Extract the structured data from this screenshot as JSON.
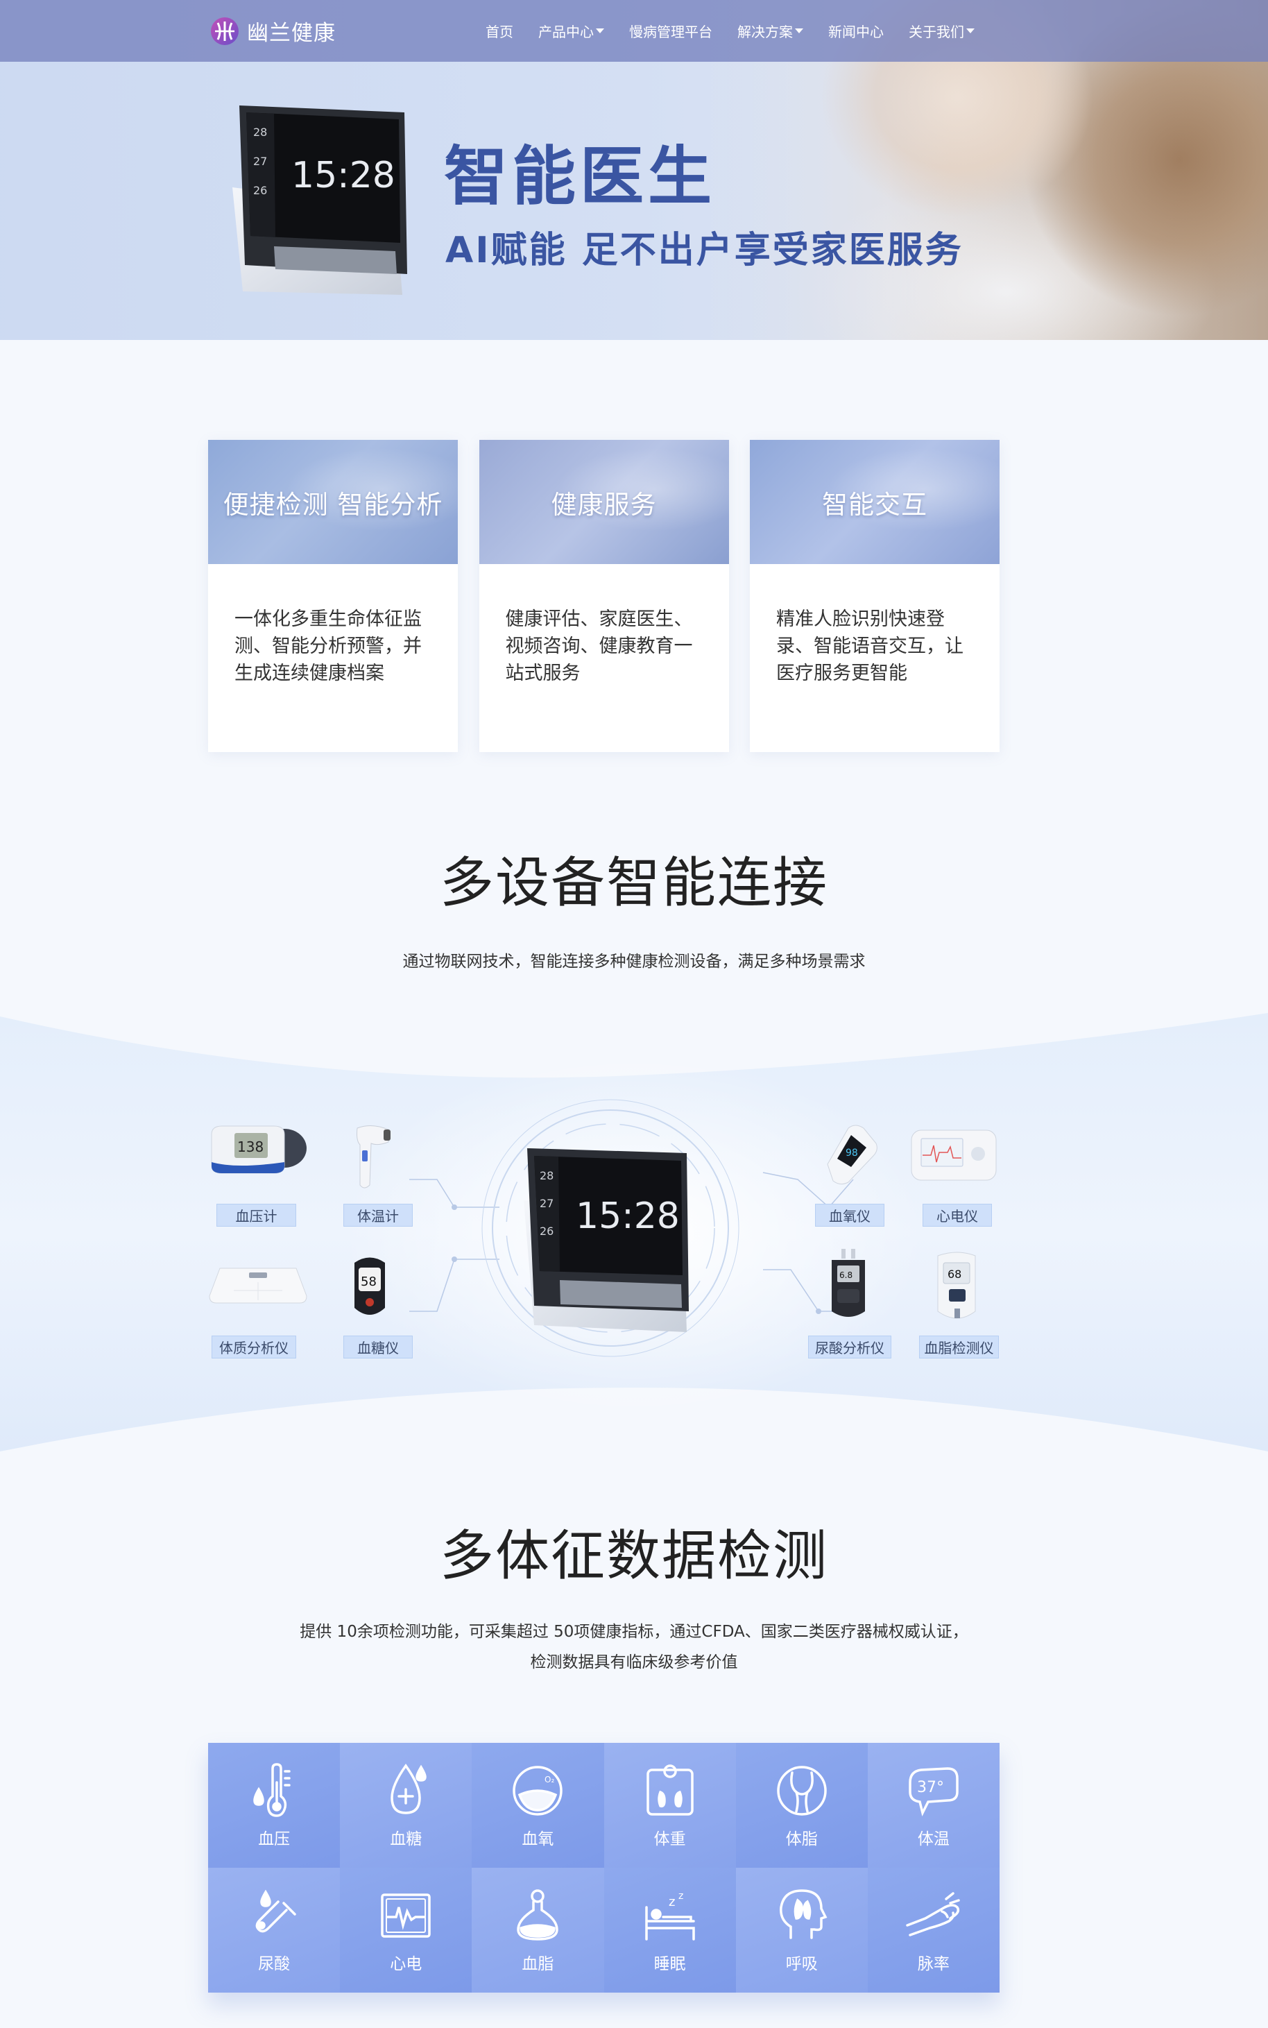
{
  "nav": {
    "logo_text": "幽兰健康",
    "items": [
      {
        "label": "首页",
        "dropdown": false
      },
      {
        "label": "产品中心",
        "dropdown": true
      },
      {
        "label": "慢病管理平台",
        "dropdown": false
      },
      {
        "label": "解决方案",
        "dropdown": true
      },
      {
        "label": "新闻中心",
        "dropdown": false
      },
      {
        "label": "关于我们",
        "dropdown": true
      }
    ]
  },
  "hero": {
    "title": "智能医生",
    "subtitle": "AI赋能  足不出户享受家医服务",
    "device_time": "15:28",
    "device_dates": [
      "28",
      "27",
      "26"
    ]
  },
  "features": [
    {
      "title": "便捷检测 智能分析",
      "body": "一体化多重生命体征监测、智能分析预警，并生成连续健康档案"
    },
    {
      "title": "健康服务",
      "body": "健康评估、家庭医生、视频咨询、健康教育一站式服务"
    },
    {
      "title": "智能交互",
      "body": "精准人脸识别快速登录、智能语音交互，让医疗服务更智能"
    }
  ],
  "connect": {
    "title": "多设备智能连接",
    "desc": "通过物联网技术，智能连接多种健康检测设备，满足多种场景需求",
    "devices_left": [
      "血压计",
      "体温计",
      "体质分析仪",
      "血糖仪"
    ],
    "devices_right": [
      "血氧仪",
      "心电仪",
      "尿酸分析仪",
      "血脂检测仪"
    ],
    "glucose_reading": "58",
    "oximeter_reading": "98",
    "lipid_reading": "68"
  },
  "vitals": {
    "title": "多体征数据检测",
    "desc_line1": "提供 10余项检测功能，可采集超过 50项健康指标，通过CFDA、国家二类医疗器械权威认证，",
    "desc_line2": "检测数据具有临床级参考价值",
    "items": [
      {
        "label": "血压",
        "icon": "thermometer-drop-icon"
      },
      {
        "label": "血糖",
        "icon": "blood-drop-plus-icon"
      },
      {
        "label": "血氧",
        "icon": "oxygen-icon"
      },
      {
        "label": "体重",
        "icon": "scale-icon"
      },
      {
        "label": "体脂",
        "icon": "body-fat-icon"
      },
      {
        "label": "体温",
        "icon": "temperature-icon"
      },
      {
        "label": "尿酸",
        "icon": "flask-drop-icon"
      },
      {
        "label": "心电",
        "icon": "ecg-icon"
      },
      {
        "label": "血脂",
        "icon": "lipid-bottle-icon"
      },
      {
        "label": "睡眠",
        "icon": "sleep-icon"
      },
      {
        "label": "呼吸",
        "icon": "head-lungs-icon"
      },
      {
        "label": "脉率",
        "icon": "hand-pulse-icon"
      }
    ],
    "temp_icon_text": "37°"
  },
  "colors": {
    "nav_bg": "#7682be",
    "hero_text": "#3a55a2",
    "grid_blue": "#7d9ae9",
    "label_bg": "#cfe0fa"
  }
}
